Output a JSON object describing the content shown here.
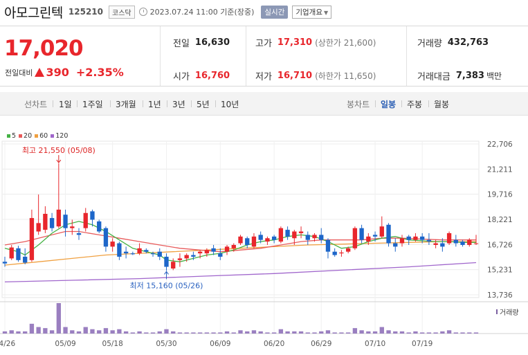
{
  "header": {
    "name": "아모그린텍",
    "code": "125210",
    "market": "코스닥",
    "timestamp": "2023.07.24 11:00 기준(장중)",
    "realtime": "실시간",
    "company": "기업개요"
  },
  "quote": {
    "price": "17,020",
    "change_label": "전일대비",
    "change": "390",
    "change_pct": "+2.35%",
    "prev_label": "전일",
    "prev": "16,630",
    "high_label": "고가",
    "high": "17,310",
    "upper_limit": "(상한가 21,600)",
    "volume_label": "거래량",
    "volume": "432,763",
    "open_label": "시가",
    "open": "16,760",
    "low_label": "저가",
    "low": "16,710",
    "lower_limit": "(하한가 11,650)",
    "amount_label": "거래대금",
    "amount": "7,383",
    "amount_unit": "백만"
  },
  "tabs": {
    "line_chart": "선차트",
    "periods": [
      "1일",
      "1주일",
      "3개월",
      "1년",
      "3년",
      "5년",
      "10년"
    ],
    "candle_chart": "봉차트",
    "candle_periods": [
      "일봉",
      "주봉",
      "월봉"
    ]
  },
  "colors": {
    "up": "#e8262c",
    "down": "#1d66c9",
    "ma5": "#44b244",
    "ma20": "#e85a5a",
    "ma60": "#f0a040",
    "ma120": "#a066cc"
  },
  "chart_data": {
    "type": "candlestick",
    "ylim": [
      13736,
      22706
    ],
    "y_ticks": [
      "22,706",
      "21,211",
      "19,716",
      "18,221",
      "16,726",
      "15,231",
      "13,736"
    ],
    "x_ticks": [
      "04/26",
      "05/09",
      "05/18",
      "05/30",
      "06/09",
      "06/20",
      "06/29",
      "07/10",
      "07/19"
    ],
    "x_tick_index": [
      0,
      9,
      16,
      24,
      32,
      40,
      47,
      55,
      62
    ],
    "annotations": {
      "high": "최고 21,550 (05/08)",
      "low": "최저 15,160 (05/26)"
    },
    "volume_label": "거래량",
    "legend": [
      {
        "name": "5",
        "color": "#44b244"
      },
      {
        "name": "20",
        "color": "#e85a5a"
      },
      {
        "name": "60",
        "color": "#f0a040"
      },
      {
        "name": "120",
        "color": "#a066cc"
      }
    ],
    "candles": [
      [
        15700,
        16000,
        15400,
        15600
      ],
      [
        15900,
        16700,
        15800,
        16550
      ],
      [
        16500,
        16650,
        15700,
        15800
      ],
      [
        16000,
        16500,
        15550,
        15650
      ],
      [
        15800,
        18800,
        15700,
        18300
      ],
      [
        17500,
        19700,
        17300,
        18000
      ],
      [
        17600,
        19000,
        17400,
        18550
      ],
      [
        18300,
        18600,
        17500,
        17700
      ],
      [
        17800,
        21550,
        17700,
        18800
      ],
      [
        18500,
        18800,
        17200,
        17700
      ],
      [
        17700,
        18200,
        17300,
        17800
      ],
      [
        17400,
        17700,
        17000,
        17300
      ],
      [
        17700,
        18900,
        17500,
        18600
      ],
      [
        18700,
        18800,
        17800,
        18200
      ],
      [
        18100,
        18200,
        17400,
        17500
      ],
      [
        17700,
        17800,
        16300,
        16600
      ],
      [
        16600,
        17100,
        16300,
        16900
      ],
      [
        16800,
        16900,
        15800,
        16000
      ],
      [
        16300,
        16600,
        15900,
        16200
      ],
      [
        16200,
        16300,
        16100,
        16150
      ],
      [
        16200,
        16800,
        16100,
        16500
      ],
      [
        16400,
        16500,
        16200,
        16300
      ],
      [
        16200,
        16300,
        16000,
        16150
      ],
      [
        16300,
        16500,
        15800,
        16000
      ],
      [
        16000,
        16200,
        15160,
        15400
      ],
      [
        15300,
        15900,
        15200,
        15700
      ],
      [
        15800,
        16200,
        15400,
        15900
      ],
      [
        15900,
        16200,
        15700,
        16100
      ],
      [
        16100,
        16300,
        15800,
        16000
      ],
      [
        16200,
        16400,
        15900,
        16300
      ],
      [
        16200,
        16500,
        16000,
        16400
      ],
      [
        16500,
        16700,
        16100,
        16300
      ],
      [
        16200,
        16500,
        15800,
        16000
      ],
      [
        16300,
        16700,
        16100,
        16600
      ],
      [
        16500,
        16800,
        16300,
        16700
      ],
      [
        16800,
        17300,
        16700,
        17200
      ],
      [
        17100,
        17200,
        16500,
        16700
      ],
      [
        16600,
        17400,
        16500,
        17200
      ],
      [
        17300,
        17500,
        16800,
        17000
      ],
      [
        16900,
        17200,
        16700,
        17100
      ],
      [
        17200,
        17300,
        16800,
        17000
      ],
      [
        16900,
        17800,
        16800,
        17700
      ],
      [
        17600,
        17800,
        17000,
        17200
      ],
      [
        17100,
        17600,
        16700,
        17500
      ],
      [
        17400,
        17800,
        17100,
        17500
      ],
      [
        17300,
        17500,
        16700,
        17000
      ],
      [
        17100,
        17400,
        16900,
        17300
      ],
      [
        17300,
        17700,
        16800,
        17000
      ],
      [
        17000,
        17100,
        15900,
        16300
      ],
      [
        16300,
        16500,
        16000,
        16100
      ],
      [
        16200,
        16400,
        16000,
        16250
      ],
      [
        16300,
        16600,
        16200,
        16500
      ],
      [
        16500,
        17800,
        16400,
        17700
      ],
      [
        17700,
        17900,
        16800,
        17000
      ],
      [
        16900,
        17400,
        16700,
        17200
      ],
      [
        17300,
        17500,
        16900,
        17200
      ],
      [
        17200,
        18400,
        17100,
        17800
      ],
      [
        17900,
        18000,
        16600,
        16800
      ],
      [
        16800,
        17100,
        16300,
        16600
      ],
      [
        16800,
        17300,
        16600,
        17100
      ],
      [
        17200,
        17300,
        16700,
        17000
      ],
      [
        17000,
        17400,
        16900,
        17200
      ],
      [
        17200,
        17400,
        16800,
        17000
      ],
      [
        17000,
        17400,
        16700,
        16900
      ],
      [
        16700,
        17000,
        16500,
        16800
      ],
      [
        16800,
        17100,
        16300,
        16600
      ],
      [
        16800,
        17500,
        16700,
        17400
      ],
      [
        17000,
        17300,
        16600,
        16800
      ],
      [
        16900,
        17000,
        16600,
        16700
      ],
      [
        16700,
        17100,
        16600,
        17000
      ],
      [
        16800,
        17300,
        16700,
        16800
      ]
    ],
    "volumes": [
      2,
      3,
      2,
      2,
      9,
      6,
      5,
      3,
      28,
      6,
      3,
      2,
      6,
      4,
      3,
      5,
      3,
      4,
      2,
      1,
      2,
      1,
      1,
      2,
      4,
      2,
      1,
      1,
      1,
      1,
      1,
      1,
      1,
      2,
      1,
      3,
      2,
      3,
      2,
      1,
      1,
      4,
      2,
      2,
      2,
      1,
      1,
      2,
      3,
      1,
      1,
      1,
      5,
      3,
      2,
      2,
      6,
      3,
      2,
      2,
      1,
      2,
      1,
      1,
      1,
      2,
      3,
      1,
      1,
      1,
      1
    ],
    "ma5": [
      [
        0,
        16500
      ],
      [
        2,
        16300
      ],
      [
        3,
        16100
      ],
      [
        5,
        16700
      ],
      [
        7,
        17400
      ],
      [
        9,
        17900
      ],
      [
        11,
        18100
      ],
      [
        13,
        17900
      ],
      [
        15,
        17500
      ],
      [
        17,
        17000
      ],
      [
        19,
        16500
      ],
      [
        21,
        16300
      ],
      [
        23,
        16100
      ],
      [
        24,
        15800
      ],
      [
        26,
        15700
      ],
      [
        28,
        15900
      ],
      [
        30,
        16100
      ],
      [
        32,
        16200
      ],
      [
        34,
        16400
      ],
      [
        36,
        16700
      ],
      [
        38,
        16900
      ],
      [
        40,
        17000
      ],
      [
        42,
        17200
      ],
      [
        44,
        17300
      ],
      [
        46,
        17200
      ],
      [
        48,
        16900
      ],
      [
        50,
        16500
      ],
      [
        52,
        16600
      ],
      [
        54,
        16900
      ],
      [
        56,
        17100
      ],
      [
        58,
        17200
      ],
      [
        60,
        17000
      ],
      [
        62,
        16950
      ],
      [
        64,
        16900
      ],
      [
        66,
        16900
      ],
      [
        68,
        16850
      ],
      [
        70,
        16850
      ]
    ],
    "ma20": [
      [
        0,
        16700
      ],
      [
        3,
        16900
      ],
      [
        6,
        17200
      ],
      [
        9,
        17500
      ],
      [
        11,
        17500
      ],
      [
        14,
        17300
      ],
      [
        17,
        17100
      ],
      [
        20,
        16900
      ],
      [
        23,
        16700
      ],
      [
        26,
        16500
      ],
      [
        29,
        16400
      ],
      [
        32,
        16300
      ],
      [
        35,
        16400
      ],
      [
        38,
        16500
      ],
      [
        41,
        16700
      ],
      [
        44,
        16900
      ],
      [
        47,
        17000
      ],
      [
        50,
        17000
      ],
      [
        53,
        17000
      ],
      [
        56,
        17100
      ],
      [
        59,
        17100
      ],
      [
        62,
        17050
      ],
      [
        65,
        17000
      ],
      [
        68,
        17000
      ],
      [
        70,
        17000
      ]
    ],
    "ma60": [
      [
        0,
        15500
      ],
      [
        5,
        15700
      ],
      [
        10,
        15900
      ],
      [
        15,
        16100
      ],
      [
        20,
        16200
      ],
      [
        25,
        16300
      ],
      [
        30,
        16400
      ],
      [
        35,
        16500
      ],
      [
        40,
        16600
      ],
      [
        45,
        16700
      ],
      [
        50,
        16750
      ],
      [
        55,
        16800
      ],
      [
        60,
        16850
      ],
      [
        65,
        16900
      ],
      [
        70,
        16900
      ]
    ],
    "ma120": [
      [
        0,
        14500
      ],
      [
        10,
        14600
      ],
      [
        20,
        14700
      ],
      [
        30,
        14850
      ],
      [
        40,
        15000
      ],
      [
        50,
        15200
      ],
      [
        60,
        15400
      ],
      [
        70,
        15650
      ]
    ]
  }
}
